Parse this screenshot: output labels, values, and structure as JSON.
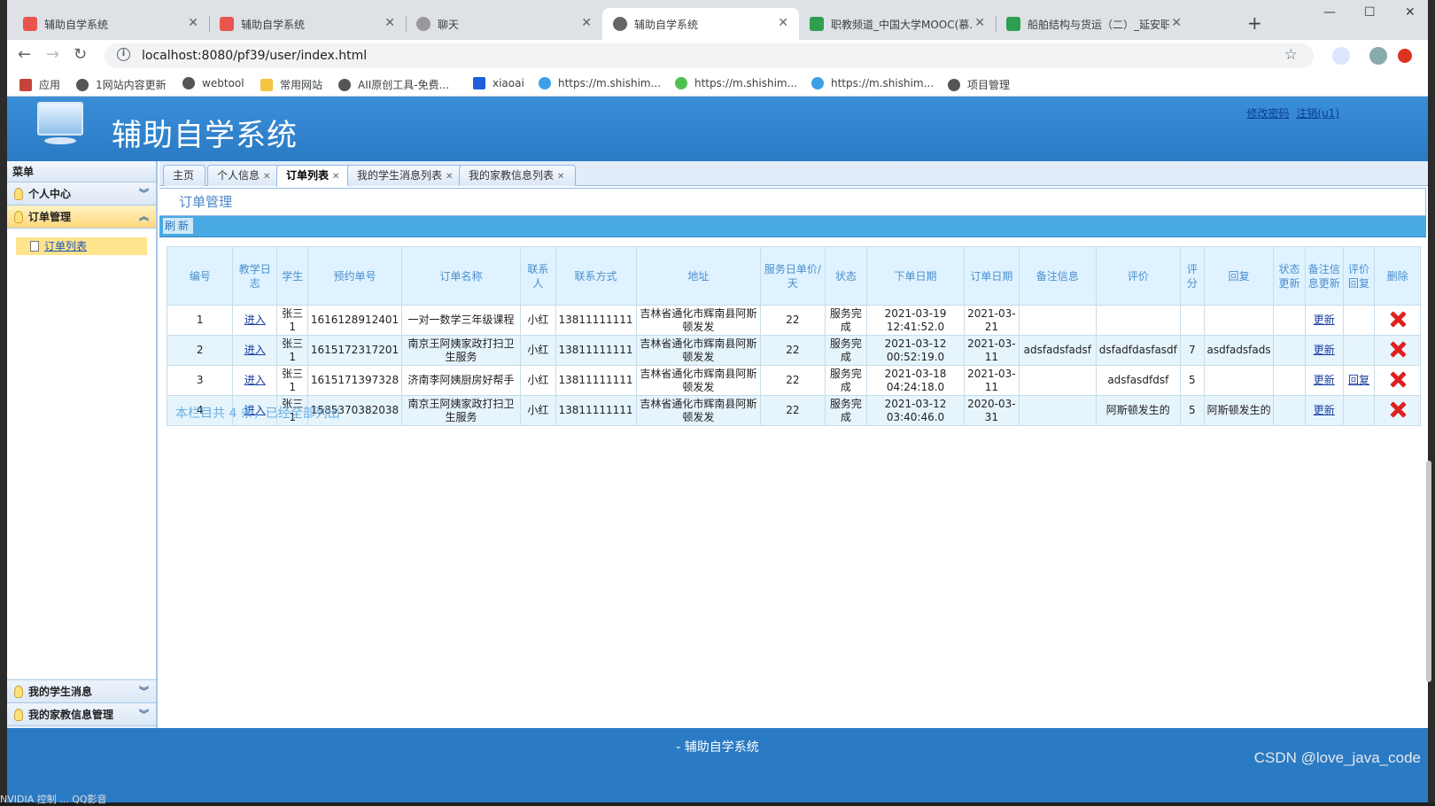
{
  "browser": {
    "tabs": [
      {
        "title": "辅助自学系统",
        "color": "#e8554e"
      },
      {
        "title": "辅助自学系统",
        "color": "#e8554e"
      },
      {
        "title": "聊天",
        "color": "#777777"
      },
      {
        "title": "辅助自学系统",
        "color": "#555555"
      },
      {
        "title": "职教频道_中国大学MOOC(慕...",
        "color": "#2e9e4f"
      },
      {
        "title": "船舶结构与货运（二）_延安职...",
        "color": "#2e9e4f"
      }
    ],
    "url": "localhost:8080/pf39/user/index.html",
    "bookmarks": [
      "应用",
      "1网站内容更新",
      "webtool",
      "常用网站",
      "AII原创工具-免费...",
      "xiaoai",
      "https://m.shishim...",
      "https://m.shishim...",
      "https://m.shishim...",
      "项目管理"
    ]
  },
  "app": {
    "title": "辅助自学系统",
    "links": {
      "change_password": "修改密码",
      "logout": "注销(u1)"
    },
    "footer": "- 辅助自学系统"
  },
  "sidebar": {
    "header": "菜单",
    "groups": [
      {
        "label": "个人中心"
      },
      {
        "label": "订单管理"
      },
      {
        "label": "我的学生消息"
      },
      {
        "label": "我的家教信息管理"
      }
    ],
    "active_item": "订单列表"
  },
  "tabs": [
    {
      "label": "主页"
    },
    {
      "label": "个人信息"
    },
    {
      "label": "订单列表"
    },
    {
      "label": "我的学生消息列表"
    },
    {
      "label": "我的家教信息列表"
    }
  ],
  "panel": {
    "title": "订单管理",
    "refresh": "刷新",
    "summary": "本栏目共 4 条，已经全部列出"
  },
  "table": {
    "columns": [
      "编号",
      "教学日志",
      "学生",
      "预约单号",
      "订单名称",
      "联系人",
      "联系方式",
      "地址",
      "服务日单价/天",
      "状态",
      "下单日期",
      "订单日期",
      "备注信息",
      "评价",
      "评分",
      "回复",
      "状态更新",
      "备注信息更新",
      "评价回复",
      "删除"
    ],
    "rows": [
      {
        "no": "1",
        "log": "进入",
        "student": "张三1",
        "booking": "1616128912401",
        "name": "一对一数学三年级课程",
        "contact": "小红",
        "phone": "13811111111",
        "address": "吉林省通化市辉南县阿斯顿发发",
        "price": "22",
        "status": "服务完成",
        "created": "2021-03-19 12:41:52.0",
        "order_date": "2021-03-21",
        "remark": "",
        "review": "",
        "score": "",
        "reply": "",
        "update": "更新",
        "review_reply": ""
      },
      {
        "no": "2",
        "log": "进入",
        "student": "张三1",
        "booking": "1615172317201",
        "name": "南京王阿姨家政打扫卫生服务",
        "contact": "小红",
        "phone": "13811111111",
        "address": "吉林省通化市辉南县阿斯顿发发",
        "price": "22",
        "status": "服务完成",
        "created": "2021-03-12 00:52:19.0",
        "order_date": "2021-03-11",
        "remark": "adsfadsfadsf",
        "review": "dsfadfdasfasdf",
        "score": "7",
        "reply": "asdfadsfads",
        "update": "更新",
        "review_reply": ""
      },
      {
        "no": "3",
        "log": "进入",
        "student": "张三1",
        "booking": "1615171397328",
        "name": "济南李阿姨厨房好帮手",
        "contact": "小红",
        "phone": "13811111111",
        "address": "吉林省通化市辉南县阿斯顿发发",
        "price": "22",
        "status": "服务完成",
        "created": "2021-03-18 04:24:18.0",
        "order_date": "2021-03-11",
        "remark": "",
        "review": "adsfasdfdsf",
        "score": "5",
        "reply": "",
        "update": "更新",
        "review_reply": "回复"
      },
      {
        "no": "4",
        "log": "进入",
        "student": "张三1",
        "booking": "1585370382038",
        "name": "南京王阿姨家政打扫卫生服务",
        "contact": "小红",
        "phone": "13811111111",
        "address": "吉林省通化市辉南县阿斯顿发发",
        "price": "22",
        "status": "服务完成",
        "created": "2021-03-12 03:40:46.0",
        "order_date": "2020-03-31",
        "remark": "",
        "review": "阿斯顿发生的",
        "score": "5",
        "reply": "阿斯顿发生的",
        "update": "更新",
        "review_reply": ""
      }
    ]
  },
  "overlay": {
    "watermark": "CSDN @love_java_code",
    "taskbar": "NVIDIA 控制 ... QQ影音"
  },
  "colors": {
    "header": "#2a7ac4",
    "accent": "#49a9e3",
    "delete": "#e0201e",
    "highlight": "#ffe48d"
  }
}
